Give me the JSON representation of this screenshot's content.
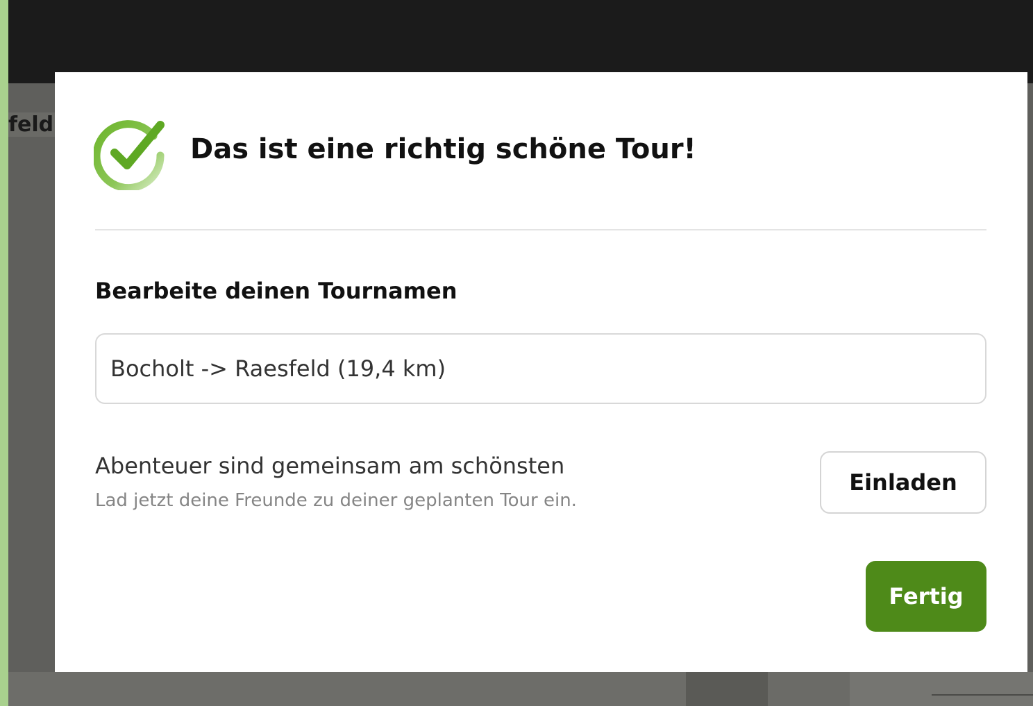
{
  "background": {
    "partial_text": "feld"
  },
  "dialog": {
    "icon": "check-circle-icon",
    "title": "Das ist eine richtig schöne Tour!",
    "name_field": {
      "label": "Bearbeite deinen Tournamen",
      "value": "Bocholt -> Raesfeld (19,4 km)"
    },
    "invite": {
      "title": "Abenteuer sind gemeinsam am schönsten",
      "subtitle": "Lad jetzt deine Freunde zu deiner geplanten Tour ein.",
      "button_label": "Einladen"
    },
    "done_label": "Fertig"
  },
  "colors": {
    "accent_green": "#4e8a19",
    "check_green": "#69b32a",
    "frame_green": "#a9d18e",
    "top_bar": "#1b1b1b"
  }
}
